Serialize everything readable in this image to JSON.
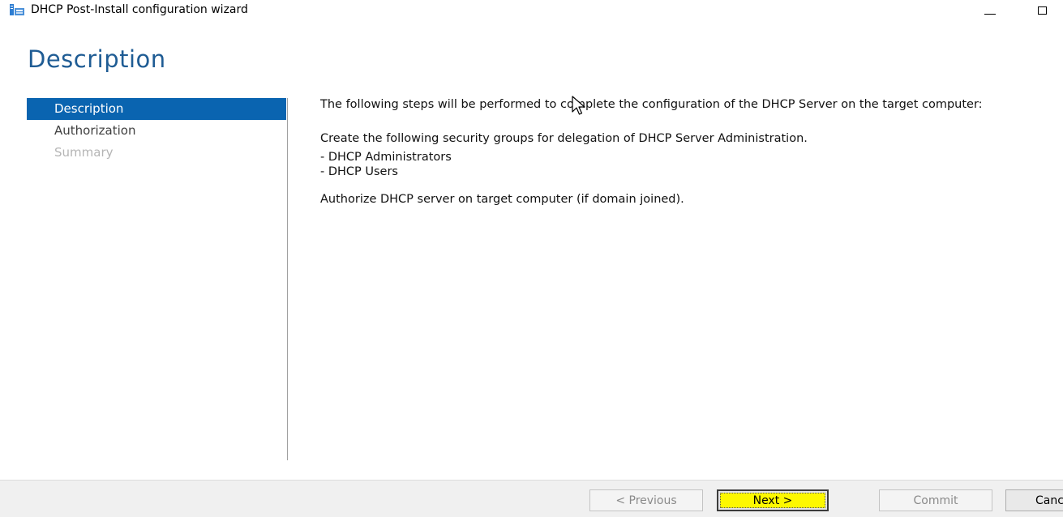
{
  "window": {
    "title": "DHCP Post-Install configuration wizard",
    "app_icon": "server-manager-icon",
    "controls": [
      "minimize-icon",
      "maximize-icon"
    ]
  },
  "page": {
    "heading": "Description"
  },
  "nav": {
    "items": [
      {
        "label": "Description",
        "state": "active"
      },
      {
        "label": "Authorization",
        "state": "enabled"
      },
      {
        "label": "Summary",
        "state": "disabled"
      }
    ]
  },
  "content": {
    "intro": "The following steps will be performed to complete the configuration of the DHCP Server on the target computer:",
    "groups_heading": "Create the following security groups for delegation of DHCP Server Administration.",
    "groups": [
      "- DHCP Administrators",
      "- DHCP Users"
    ],
    "authorize": "Authorize DHCP server on target computer (if domain joined)."
  },
  "footer": {
    "previous_label": "< Previous",
    "next_label": "Next >",
    "commit_label": "Commit",
    "cancel_label": "Cancel"
  },
  "colors": {
    "accent": "#0a64b0",
    "heading": "#1f5c94",
    "highlight": "#fdf800"
  }
}
